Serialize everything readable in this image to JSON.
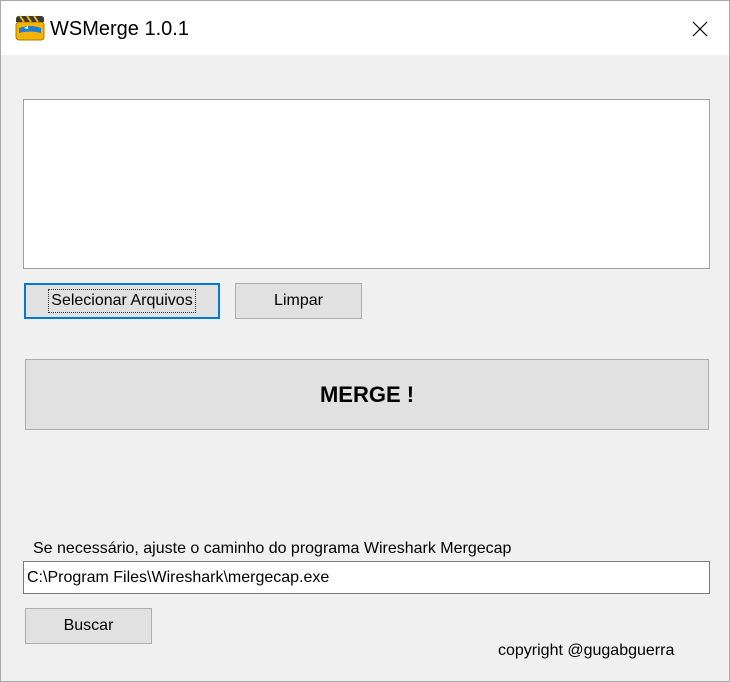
{
  "window": {
    "title": "WSMerge 1.0.1",
    "icon": "clapperboard-shark-icon",
    "close_icon": "close-icon"
  },
  "files_list": {
    "items": []
  },
  "buttons": {
    "select_files": "Selecionar Arquivos",
    "clear": "Limpar",
    "merge": "MERGE !",
    "browse": "Buscar"
  },
  "mergecap": {
    "label": "Se necessário, ajuste o caminho do programa Wireshark Mergecap",
    "path": "C:\\Program Files\\Wireshark\\mergecap.exe"
  },
  "footer": {
    "copyright": "copyright @gugabguerra"
  },
  "colors": {
    "background": "#f0f0f0",
    "button_face": "#e1e1e1",
    "focus_border": "#0078d7",
    "icon_yellow": "#f5b400",
    "icon_blue": "#1f7fd0"
  }
}
